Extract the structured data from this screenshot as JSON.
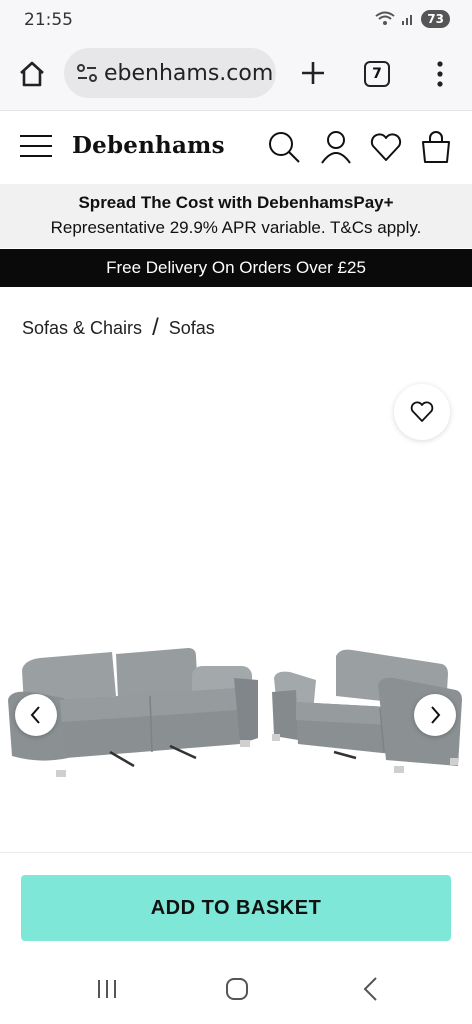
{
  "status": {
    "time": "21:55",
    "battery": "73"
  },
  "browser": {
    "url": "ebenhams.com",
    "tab_count": "7"
  },
  "site": {
    "logo": "Debenhams"
  },
  "promo": {
    "title": "Spread The Cost with DebenhamsPay+",
    "subtitle": "Representative 29.9% APR variable. T&Cs apply."
  },
  "delivery": {
    "text": "Free Delivery On Orders Over £25"
  },
  "breadcrumb": {
    "items": [
      "Sofas & Chairs",
      "Sofas"
    ],
    "separator": "/"
  },
  "product": {
    "image_icon": "sofa-set-image"
  },
  "cta": {
    "add_to_basket": "ADD TO BASKET"
  },
  "colors": {
    "accent": "#7fe7d7",
    "banner": "#0a0a0a",
    "promo_bg": "#f1f1f1",
    "sofa": "#8e9496"
  }
}
